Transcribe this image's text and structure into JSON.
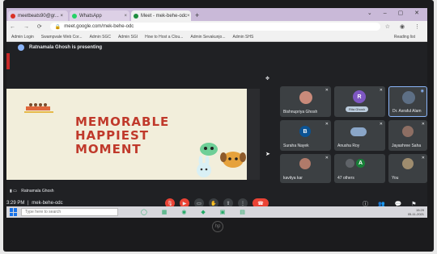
{
  "browser": {
    "tabs": [
      {
        "label": "meetbeats90@gr... ×",
        "color": "#d93025"
      },
      {
        "label": "WhatsApp",
        "color": "#25d366"
      },
      {
        "label": "Meet - mek-behe-odc",
        "color": "#1e8e3e"
      }
    ],
    "new_tab": "+",
    "url": "meet.google.com/mek-behe-odc",
    "bookmarks": [
      "Admin Login",
      "Swampvale Web Cor...",
      "Admin SGC",
      "Admin SGI",
      "How to Host a Clou...",
      "Admin Sevakunjo...",
      "Admin SHS"
    ],
    "reading_list": "Reading list"
  },
  "meet": {
    "presenting": "Ratnamala Ghosh is presenting",
    "slide": {
      "line1": "MEMORABLE",
      "line2": "HAPPIEST",
      "line3": "MOMENT"
    },
    "participants": [
      {
        "name": "Bishnupriya Ghosh",
        "initial": "",
        "color": "#c98a7a"
      },
      {
        "name": "Rita Ghosh",
        "initial": "R",
        "color": "#7e57c2"
      },
      {
        "name": "Dr. Asraful Alam",
        "initial": "",
        "color": "#5d6f85"
      },
      {
        "name": "Suraha Nayek",
        "initial": "B",
        "color": "#0b5394"
      },
      {
        "name": "Anusha Roy",
        "initial": "",
        "color": "#8aa6c8"
      },
      {
        "name": "Jayashree Saha",
        "initial": "",
        "color": "#8d6e63"
      },
      {
        "name": "kavitya kar",
        "initial": "",
        "color": "#b07a6a"
      },
      {
        "name": "47 others",
        "initial": "A",
        "color": "#188038"
      },
      {
        "name": "You",
        "initial": "",
        "color": "#9e8c6e"
      }
    ],
    "presenter_name": "Ratnamala Ghosh",
    "time": "3:29 PM",
    "meeting_code": "mek-behe-odc"
  },
  "taskbar": {
    "search_placeholder": "Type here to search",
    "date": "05-11-2021",
    "clock": "15:29"
  },
  "brand": "hp"
}
